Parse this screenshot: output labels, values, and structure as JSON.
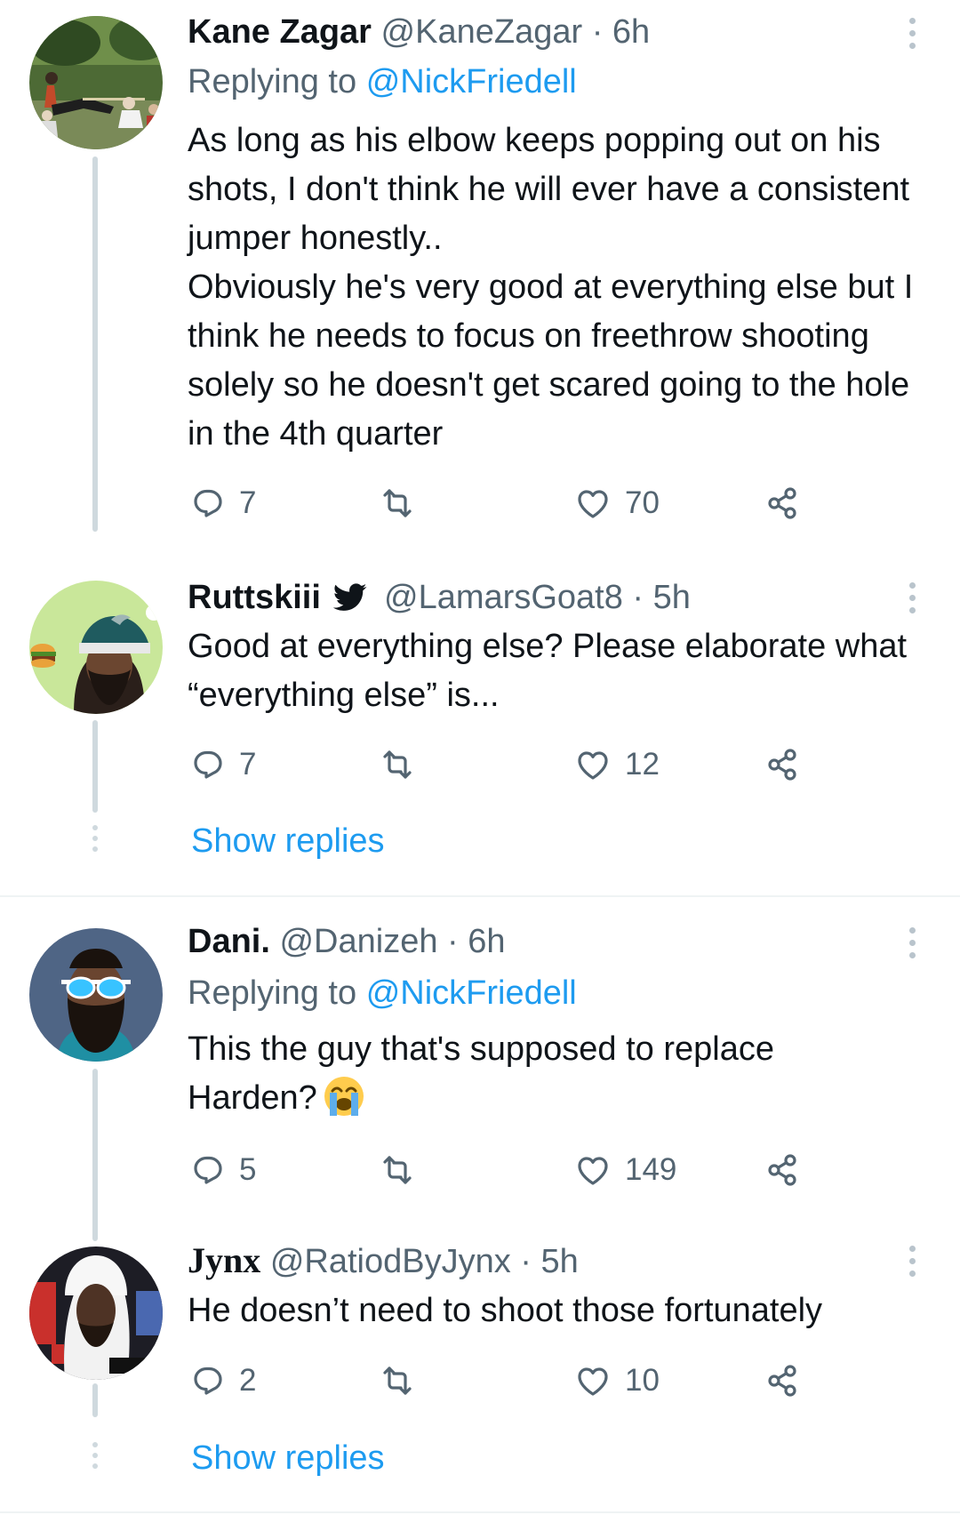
{
  "tweets": [
    {
      "name": "Kane Zagar",
      "handle": "@KaneZagar",
      "time": "6h",
      "replying_label": "Replying to",
      "replying_to": "@NickFriedell",
      "lines": [
        "As long as his elbow keeps popping out on his shots, I don't think he will ever have a consistent jumper honestly..",
        "Obviously he's very good at everything else but I think he needs to focus on freethrow shooting solely so he doesn't get scared going to the hole in the 4th quarter"
      ],
      "replies": "7",
      "likes": "70"
    },
    {
      "name": "Ruttskiii",
      "handle": "@LamarsGoat8",
      "time": "5h",
      "lines": [
        "Good at everything else? Please elaborate what “everything else” is..."
      ],
      "replies": "7",
      "likes": "12"
    },
    {
      "name": "Dani.",
      "handle": "@Danizeh",
      "time": "6h",
      "replying_label": "Replying to",
      "replying_to": "@NickFriedell",
      "lines": [
        "This the guy that's supposed to replace Harden?"
      ],
      "replies": "5",
      "likes": "149"
    },
    {
      "name": "Jynx",
      "handle": "@RatiodByJynx",
      "time": "5h",
      "lines": [
        "He doesn’t need to shoot those fortunately"
      ],
      "replies": "2",
      "likes": "10"
    }
  ],
  "show_replies_label": "Show replies",
  "separator": "·",
  "icons": {
    "reply": "reply-icon",
    "retweet": "retweet-icon",
    "like": "heart-icon",
    "share": "share-icon",
    "more": "more-icon",
    "verified": "twitter-bird-icon",
    "emoji": "loudly-crying-face-emoji"
  },
  "colors": {
    "link": "#1d9bf0",
    "secondary_text": "#536471",
    "thread_line": "#cfd9de"
  }
}
